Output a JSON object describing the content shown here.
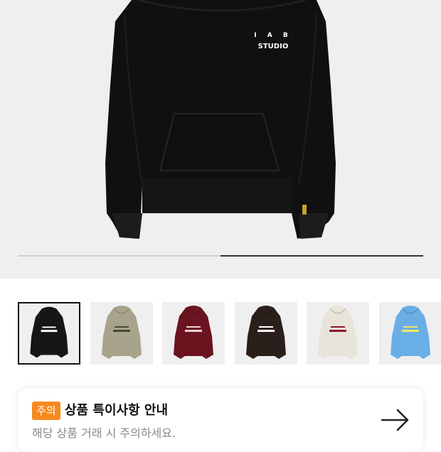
{
  "product": {
    "print_line1": "I A B",
    "print_line2": "STUDIO",
    "image_index": 2,
    "image_count": 2
  },
  "thumbnails": [
    {
      "color": "#161616",
      "print": "#ffffff",
      "selected": true
    },
    {
      "color": "#a8a48c",
      "print": "#4a4a3a",
      "selected": false
    },
    {
      "color": "#6b1420",
      "print": "#f0d0d0",
      "selected": false
    },
    {
      "color": "#2a1f1a",
      "print": "#ffffff",
      "selected": false
    },
    {
      "color": "#e9e4da",
      "print": "#8a1a2a",
      "selected": false
    },
    {
      "color": "#6aaee6",
      "print": "#f2e76a",
      "selected": false
    }
  ],
  "notice": {
    "badge": "주의",
    "title": "상품 특이사항 안내",
    "subtitle": "해당 상품 거래 시 주의하세요.",
    "arrow_icon": "arrow-right-icon"
  },
  "colors": {
    "hero_bg": "#efefef",
    "badge_bg": "#f58a1f"
  }
}
